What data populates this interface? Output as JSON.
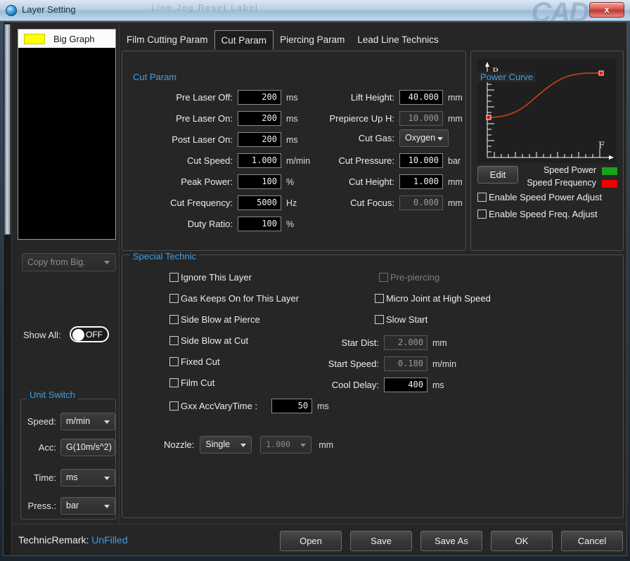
{
  "window": {
    "title": "Layer Setting",
    "close_label": "x",
    "ghost_text": "Line     Jog     Reset Label"
  },
  "sidebar": {
    "layers": [
      {
        "name": "Big Graph",
        "color": "#ffff00"
      }
    ],
    "copy_from": "Copy from Big.",
    "show_all_label": "Show All:",
    "show_all_state": "OFF",
    "unit_switch": {
      "legend": "Unit Switch",
      "rows": [
        {
          "label": "Speed:",
          "value": "m/min"
        },
        {
          "label": "Acc:",
          "value": "G(10m/s^2)"
        },
        {
          "label": "Time:",
          "value": "ms"
        },
        {
          "label": "Press.:",
          "value": "bar"
        }
      ]
    }
  },
  "tabs": [
    {
      "label": "Film Cutting Param",
      "active": false
    },
    {
      "label": "Cut Param",
      "active": true
    },
    {
      "label": "Piercing Param",
      "active": false
    },
    {
      "label": "Lead Line Technics",
      "active": false
    }
  ],
  "cut_param": {
    "legend": "Cut Param",
    "left": [
      {
        "label": "Pre Laser Off:",
        "value": "200",
        "unit": "ms",
        "disabled": false
      },
      {
        "label": "Pre Laser On:",
        "value": "200",
        "unit": "ms",
        "disabled": false
      },
      {
        "label": "Post Laser On:",
        "value": "200",
        "unit": "ms",
        "disabled": false
      },
      {
        "label": "Cut Speed:",
        "value": "1.000",
        "unit": "m/min",
        "disabled": false
      },
      {
        "label": "Peak Power:",
        "value": "100",
        "unit": "%",
        "disabled": false
      },
      {
        "label": "Cut Frequency:",
        "value": "5000",
        "unit": "Hz",
        "disabled": false
      },
      {
        "label": "Duty Ratio:",
        "value": "100",
        "unit": "%",
        "disabled": false
      }
    ],
    "right": [
      {
        "label": "Lift Height:",
        "value": "40.000",
        "unit": "mm",
        "disabled": false
      },
      {
        "label": "Prepierce Up H:",
        "value": "10.000",
        "unit": "mm",
        "disabled": true
      },
      {
        "label": "Cut Pressure:",
        "value": "10.000",
        "unit": "bar",
        "disabled": false
      },
      {
        "label": "Cut Height:",
        "value": "1.000",
        "unit": "mm",
        "disabled": false
      },
      {
        "label": "Cut Focus:",
        "value": "0.000",
        "unit": "mm",
        "disabled": true
      }
    ],
    "cut_gas": {
      "label": "Cut Gas:",
      "value": "Oxygen"
    }
  },
  "power_curve": {
    "legend": "Power Curve",
    "y_axis_label": "P",
    "x_axis_label": "F",
    "edit_label": "Edit",
    "legend_items": [
      {
        "label": "Speed Power",
        "color": "#17a317"
      },
      {
        "label": "Speed Frequency",
        "color": "#f20000"
      }
    ],
    "checkboxes": [
      {
        "label": "Enable Speed Power Adjust",
        "checked": false
      },
      {
        "label": "Enable Speed Freq. Adjust",
        "checked": false
      }
    ],
    "curve_color": "#c8421a",
    "point_color": "#ff0000"
  },
  "chart_data": {
    "type": "line",
    "title": "Power Curve",
    "xlabel": "F",
    "ylabel": "P",
    "grid": false,
    "legend_position": "right",
    "x": [
      0,
      0.12,
      0.25,
      0.38,
      0.5,
      0.62,
      0.75,
      0.88,
      1.0
    ],
    "y": [
      0.4,
      0.41,
      0.45,
      0.53,
      0.62,
      0.71,
      0.78,
      0.81,
      0.82
    ],
    "xlim": [
      0,
      1
    ],
    "ylim": [
      0,
      1
    ],
    "series": [
      {
        "name": "Speed Frequency",
        "color": "#c8421a",
        "values": [
          0.4,
          0.41,
          0.45,
          0.53,
          0.62,
          0.71,
          0.78,
          0.81,
          0.82
        ]
      }
    ],
    "markers": [
      {
        "x": 0.0,
        "y": 0.4
      },
      {
        "x": 1.0,
        "y": 0.82
      }
    ]
  },
  "special_technic": {
    "legend": "Special Technic",
    "left_checkboxes": [
      {
        "label": "Ignore This Layer",
        "checked": false,
        "disabled": false
      },
      {
        "label": "Gas Keeps On for This Layer",
        "checked": false,
        "disabled": false
      },
      {
        "label": "Side Blow at Pierce",
        "checked": false,
        "disabled": false
      },
      {
        "label": "Side Blow at Cut",
        "checked": false,
        "disabled": false
      },
      {
        "label": "Fixed Cut",
        "checked": false,
        "disabled": false
      },
      {
        "label": "Film Cut",
        "checked": false,
        "disabled": false
      }
    ],
    "gxx": {
      "label": "Gxx AccVaryTime :",
      "checked": false,
      "value": "50",
      "unit": "ms"
    },
    "right_checkboxes": [
      {
        "label": "Pre-piercing",
        "checked": false,
        "disabled": true
      },
      {
        "label": "Micro Joint at High Speed",
        "checked": false,
        "disabled": false
      },
      {
        "label": "Slow Start",
        "checked": false,
        "disabled": false
      }
    ],
    "right_fields": [
      {
        "label": "Star Dist:",
        "value": "2.000",
        "unit": "mm",
        "disabled": true
      },
      {
        "label": "Start Speed:",
        "value": "0.180",
        "unit": "m/min",
        "disabled": true
      },
      {
        "label": "Cool Delay:",
        "value": "400",
        "unit": "ms",
        "disabled": false
      }
    ],
    "nozzle": {
      "label": "Nozzle:",
      "type_value": "Single",
      "size_value": "1.000",
      "unit": "mm"
    }
  },
  "footer": {
    "remark_label": "TechnicRemark:",
    "remark_value": "UnFilled",
    "buttons": [
      "Open",
      "Save",
      "Save As",
      "OK",
      "Cancel"
    ]
  }
}
